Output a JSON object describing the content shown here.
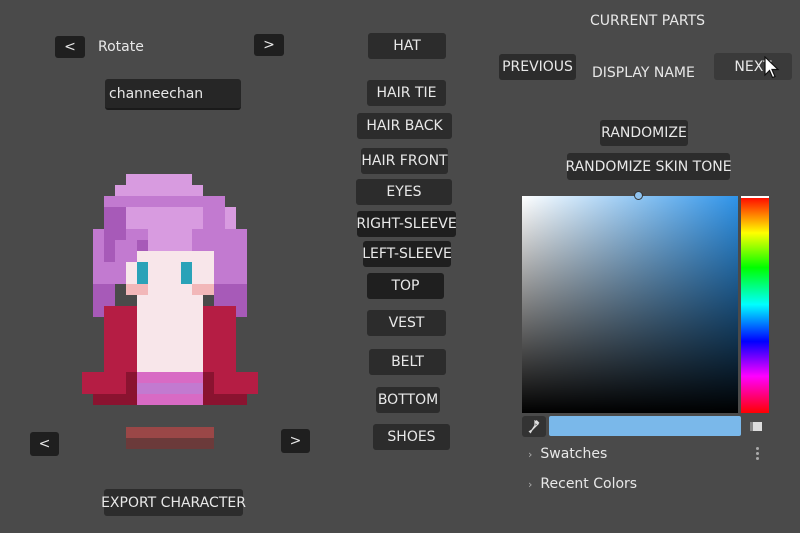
{
  "left_panel": {
    "rotate_label": "Rotate",
    "prev_arrow": "<",
    "next_arrow": ">",
    "name_value": "channeechan",
    "export_label": "EXPORT CHARACTER"
  },
  "parts": [
    "HAT",
    "HAIR TIE",
    "HAIR BACK",
    "HAIR FRONT",
    "EYES",
    "RIGHT-SLEEVE",
    "LEFT-SLEEVE",
    "TOP",
    "VEST",
    "BELT",
    "BOTTOM",
    "SHOES"
  ],
  "right_panel": {
    "current_parts_title": "CURRENT PARTS",
    "previous_label": "PREVIOUS",
    "display_name_label": "DISPLAY NAME",
    "next_label": "NEXT",
    "randomize_label": "RANDOMIZE",
    "randomize_skin_label": "RANDOMIZE SKIN TONE",
    "color_picker": {
      "current_color": "#7ab8ea",
      "hue_color": "#2f94e9",
      "swatches_label": "Swatches",
      "recent_colors_label": "Recent Colors"
    }
  },
  "sprite_colors": {
    "hair_light": "#d89be0",
    "hair_mid": "#c27ad0",
    "hair_dark": "#a75ab8",
    "skin": "#f8e6ea",
    "blush": "#f2b7b9",
    "eye": "#2aa2b8",
    "vest": "#b51d44",
    "vest_dark": "#8a1330",
    "skirt": "#d86ac4",
    "shoes": "#9a4747",
    "shadow": "#6b3a3a"
  }
}
